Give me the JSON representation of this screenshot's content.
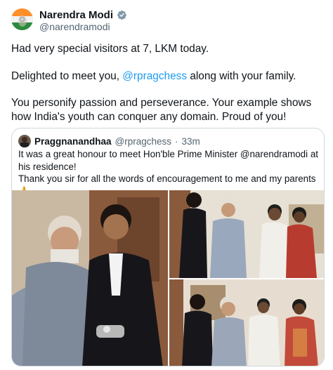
{
  "author": {
    "display_name": "Narendra Modi",
    "handle": "@narendramodi"
  },
  "tweet": {
    "line1": "Had very special visitors at 7, LKM today.",
    "line2_prefix": "Delighted to meet you, ",
    "line2_mention": "@rpragchess",
    "line2_suffix": " along with your family.",
    "line3": "You personify passion and perseverance. Your example shows how India's youth can conquer any domain. Proud of you!"
  },
  "quoted": {
    "display_name": "Praggnanandhaa",
    "handle": "@rpragchess",
    "separator": "·",
    "time": "33m",
    "line1": "It was a great honour to meet Hon'ble Prime Minister @narendramodi at his residence!",
    "line2": "Thank you sir for all the words of encouragement to me and my parents",
    "emoji": "🙏"
  },
  "colors": {
    "link": "#1d9bf0",
    "verified_badge": "#829aab",
    "secondary_text": "#536471",
    "border": "#cfd9de"
  }
}
